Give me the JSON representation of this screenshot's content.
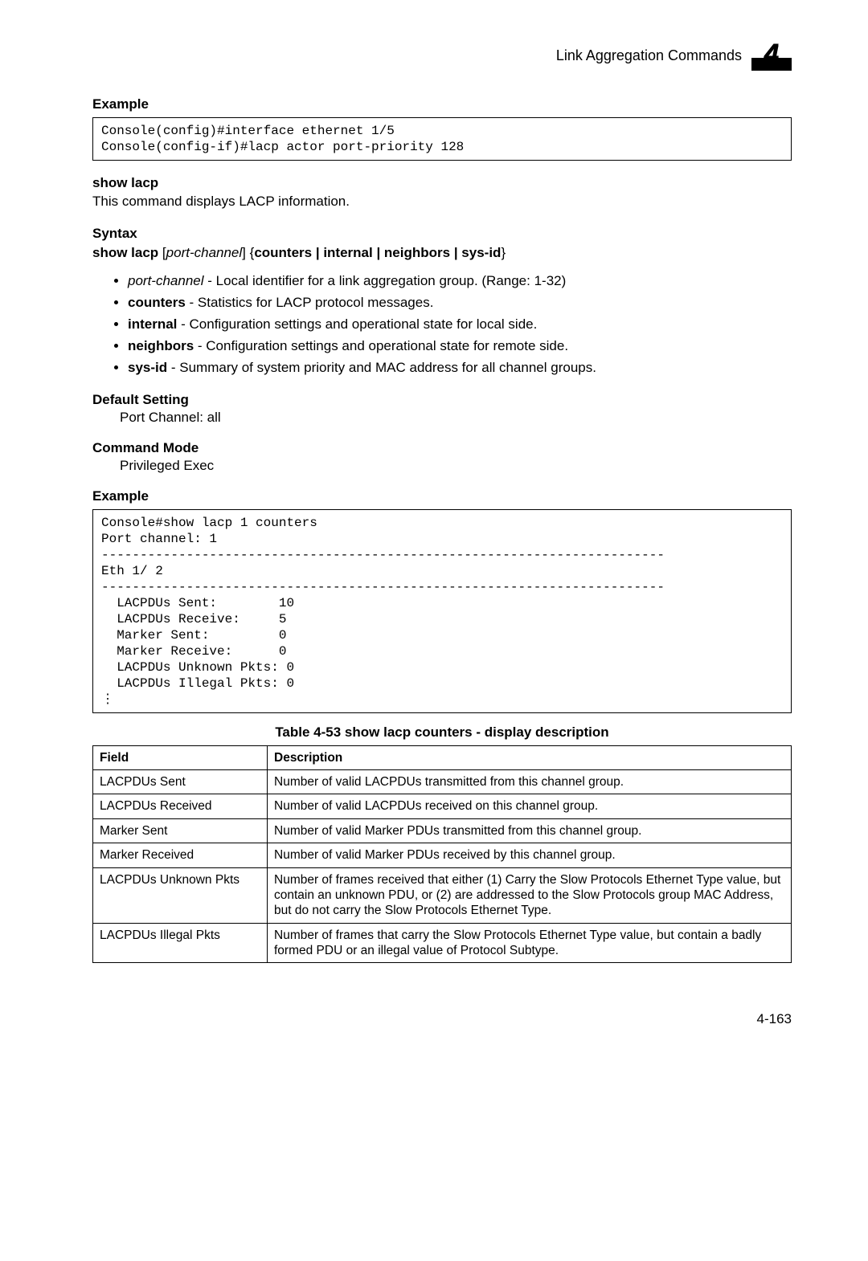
{
  "header": {
    "title": "Link Aggregation Commands",
    "chapter_number": "4"
  },
  "sections": {
    "example1_heading": "Example",
    "code1": "Console(config)#interface ethernet 1/5\nConsole(config-if)#lacp actor port-priority 128",
    "show_lacp_heading": "show lacp",
    "show_lacp_desc": "This command displays LACP information.",
    "syntax_heading": "Syntax",
    "syntax": {
      "cmd": "show lacp",
      "arg_ital": "port-channel",
      "opts": "counters | internal | neighbors | sys-id",
      "lb": "[",
      "rb": "]",
      "lc": "{",
      "rc": "}"
    },
    "params": [
      {
        "name": "port-channel",
        "style": "ital",
        "desc": " - Local identifier for a link aggregation group. (Range: 1-32)"
      },
      {
        "name": "counters",
        "style": "bold",
        "desc": " - Statistics for LACP protocol messages."
      },
      {
        "name": "internal",
        "style": "bold",
        "desc": " - Configuration settings and operational state for local side."
      },
      {
        "name": "neighbors",
        "style": "bold",
        "desc": " - Configuration settings and operational state for remote side."
      },
      {
        "name": "sys-id",
        "style": "bold",
        "desc": " - Summary of system priority and MAC address for all channel groups."
      }
    ],
    "default_heading": "Default Setting",
    "default_value": "Port Channel: all",
    "mode_heading": "Command Mode",
    "mode_value": "Privileged Exec",
    "example2_heading": "Example",
    "code2": "Console#show lacp 1 counters\nPort channel: 1\n-------------------------------------------------------------------------\nEth 1/ 2\n-------------------------------------------------------------------------\n  LACPDUs Sent:        10\n  LACPDUs Receive:     5\n  Marker Sent:         0\n  Marker Receive:      0\n  LACPDUs Unknown Pkts: 0\n  LACPDUs Illegal Pkts: 0\n⋮"
  },
  "table": {
    "caption": "Table 4-53   show lacp counters - display description",
    "headers": {
      "field": "Field",
      "desc": "Description"
    },
    "rows": [
      {
        "field": "LACPDUs Sent",
        "desc": "Number of valid LACPDUs transmitted from this channel group."
      },
      {
        "field": "LACPDUs Received",
        "desc": "Number of valid LACPDUs received on this channel group."
      },
      {
        "field": "Marker Sent",
        "desc": "Number of valid Marker PDUs transmitted from this channel group."
      },
      {
        "field": "Marker Received",
        "desc": "Number of valid Marker PDUs received by this channel group."
      },
      {
        "field": "LACPDUs Unknown Pkts",
        "desc": "Number of frames received that either (1) Carry the Slow Protocols Ethernet Type value, but contain an unknown PDU, or (2) are addressed to the Slow Protocols group MAC Address, but do not carry the Slow Protocols Ethernet Type."
      },
      {
        "field": "LACPDUs Illegal Pkts",
        "desc": "Number of frames that carry the Slow Protocols Ethernet Type value, but contain a badly formed PDU or an illegal value of Protocol Subtype."
      }
    ]
  },
  "footer": {
    "page": "4-163"
  }
}
